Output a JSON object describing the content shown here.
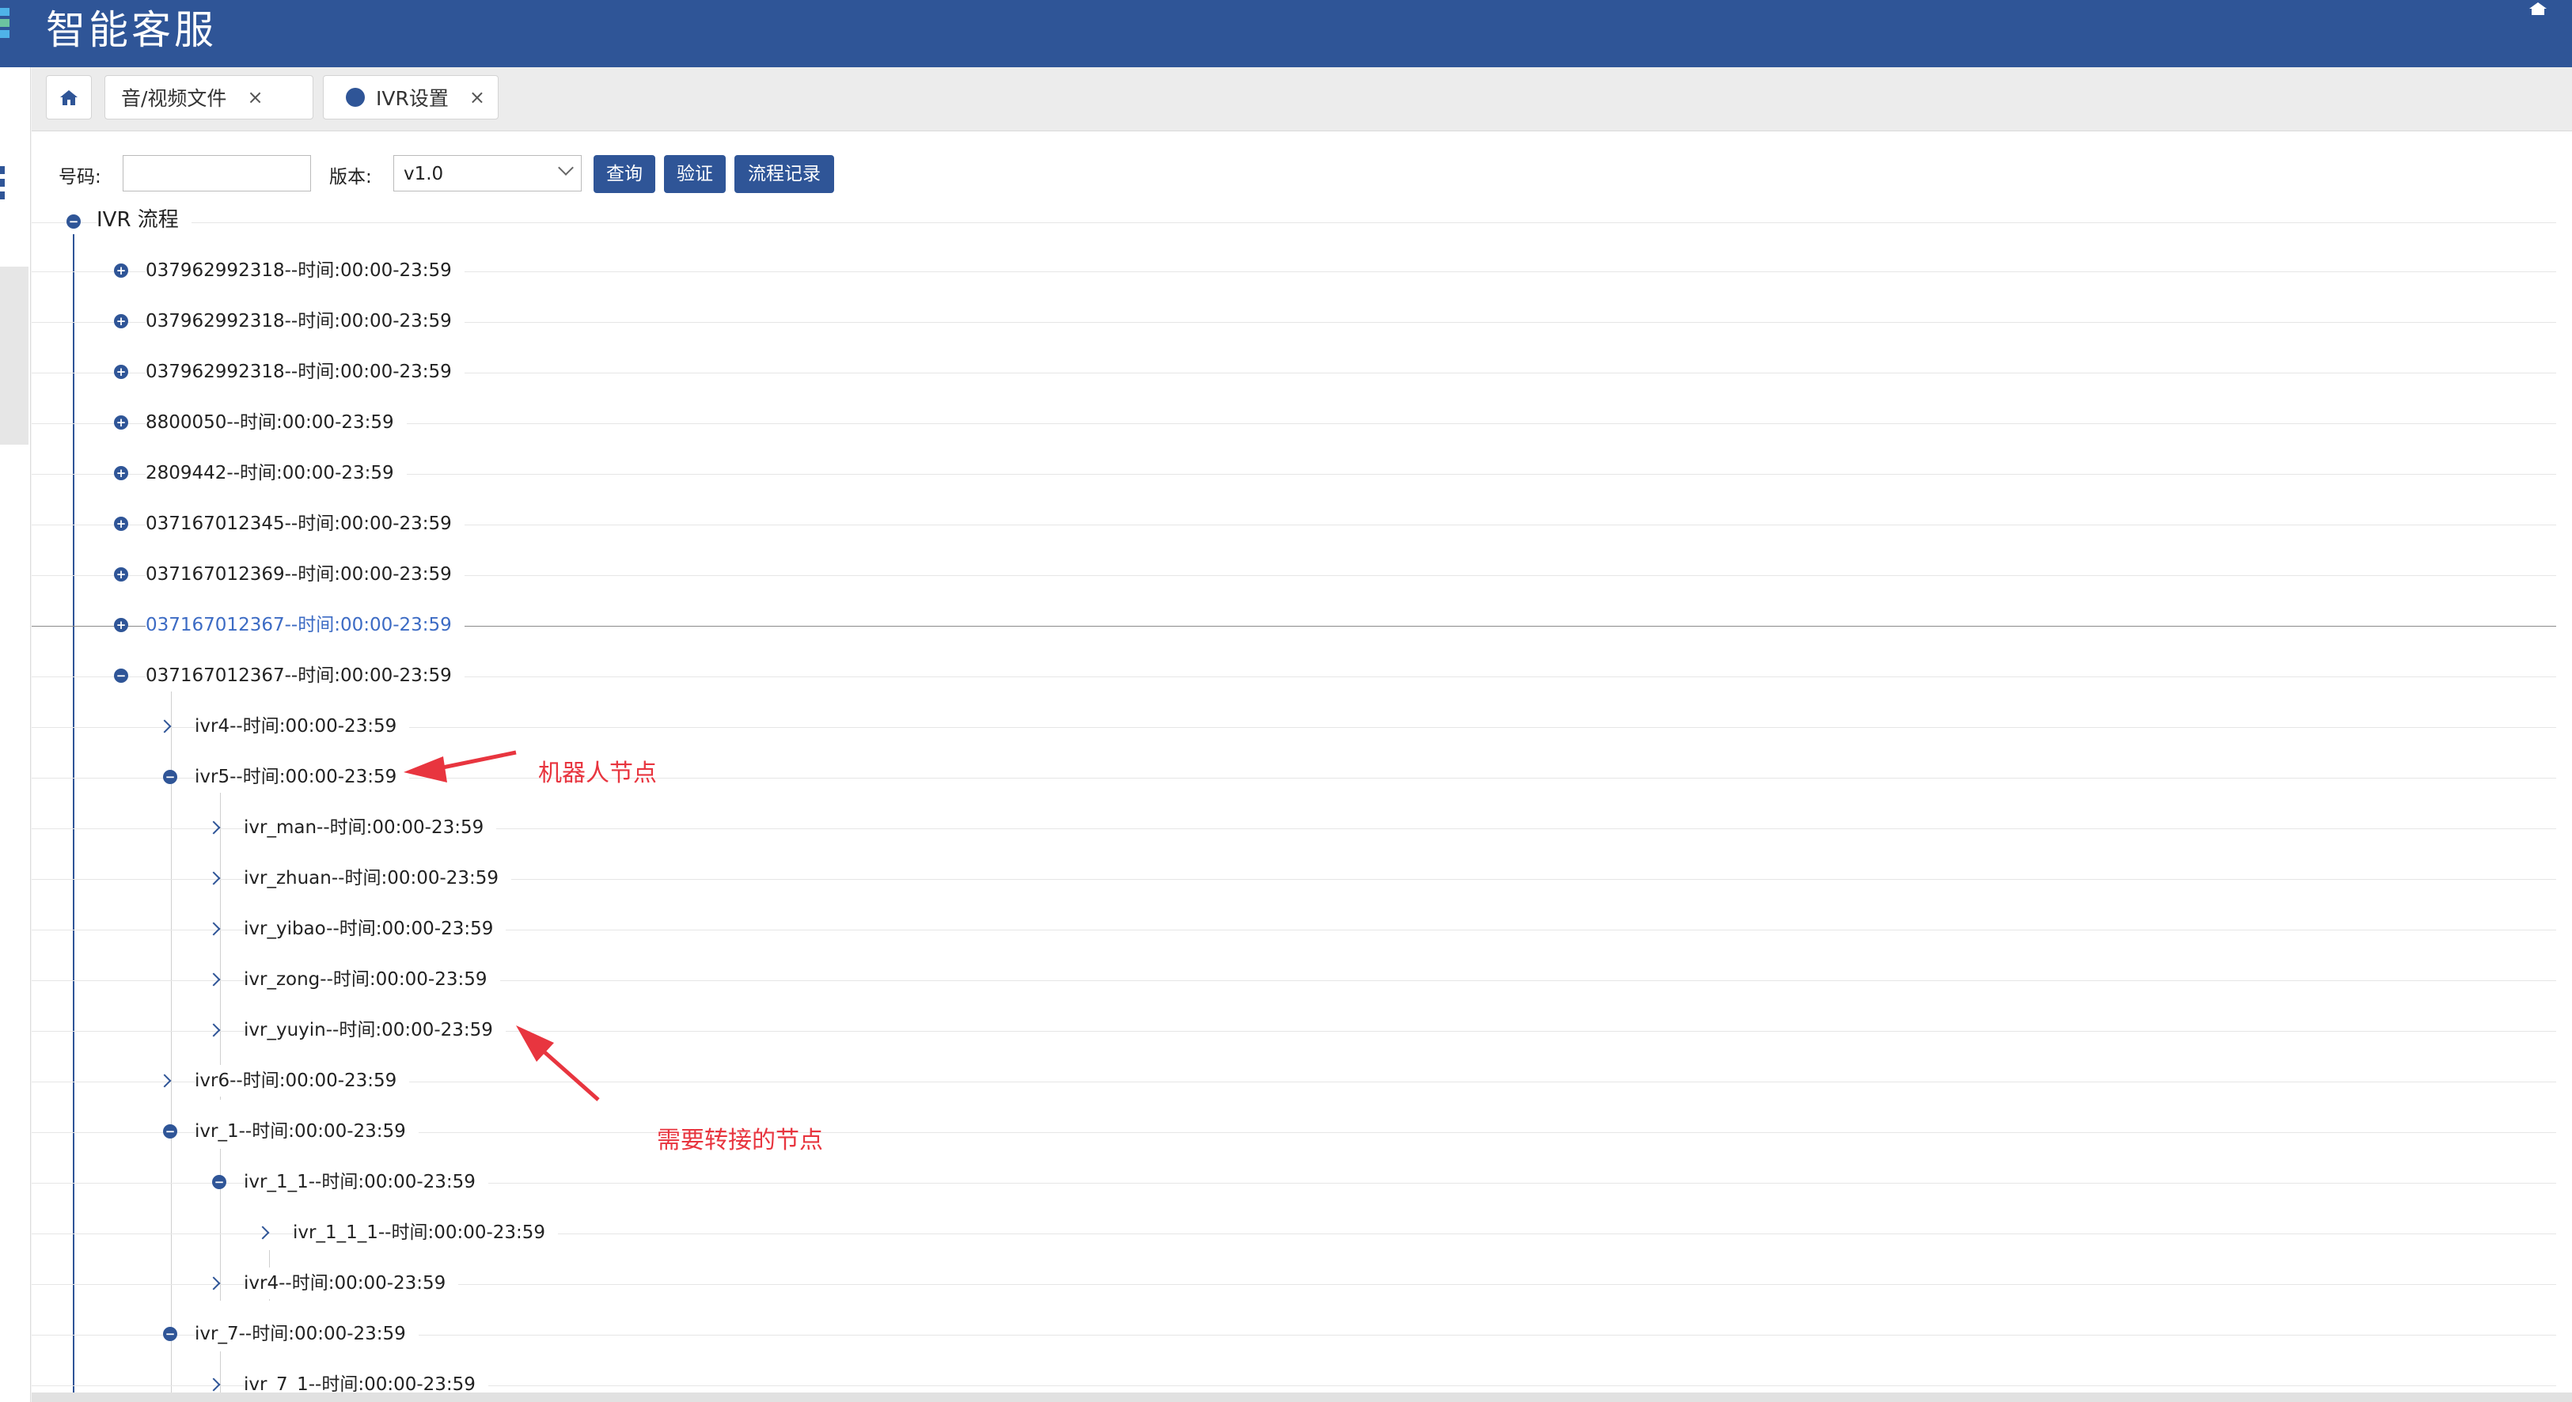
{
  "header": {
    "app_title": "智能客服",
    "brand_color": "#2f5597",
    "home_icon": "home-icon"
  },
  "tabs": [
    {
      "icon": "home-icon"
    },
    {
      "label": "音/视频文件",
      "close": "×"
    },
    {
      "label": "IVR设置",
      "close": "×"
    }
  ],
  "search": {
    "number_label": "号码:",
    "number_value": "",
    "version_label": "版本:",
    "version_value": "v1.0",
    "query_button": "查询",
    "verify_button": "验证",
    "history_button": "流程记录"
  },
  "tree": {
    "root": "IVR 流程",
    "nodes": [
      "037962992318--时间:00:00-23:59",
      "037962992318--时间:00:00-23:59",
      "037962992318--时间:00:00-23:59",
      "8800050--时间:00:00-23:59",
      "2809442--时间:00:00-23:59",
      "037167012345--时间:00:00-23:59",
      "037167012369--时间:00:00-23:59",
      "037167012367--时间:00:00-23:59",
      "037167012367--时间:00:00-23:59",
      "ivr4--时间:00:00-23:59",
      "ivr5--时间:00:00-23:59",
      "ivr_man--时间:00:00-23:59",
      "ivr_zhuan--时间:00:00-23:59",
      "ivr_yibao--时间:00:00-23:59",
      "ivr_zong--时间:00:00-23:59",
      "ivr_yuyin--时间:00:00-23:59",
      "ivr6--时间:00:00-23:59",
      "ivr_1--时间:00:00-23:59",
      "ivr_1_1--时间:00:00-23:59",
      "ivr_1_1_1--时间:00:00-23:59",
      "ivr4--时间:00:00-23:59",
      "ivr_7--时间:00:00-23:59",
      "ivr_7_1--时间:00:00-23:59"
    ]
  },
  "annotations": {
    "robot_node": "机器人节点",
    "transfer_node": "需要转接的节点",
    "color": "#e8353f"
  }
}
